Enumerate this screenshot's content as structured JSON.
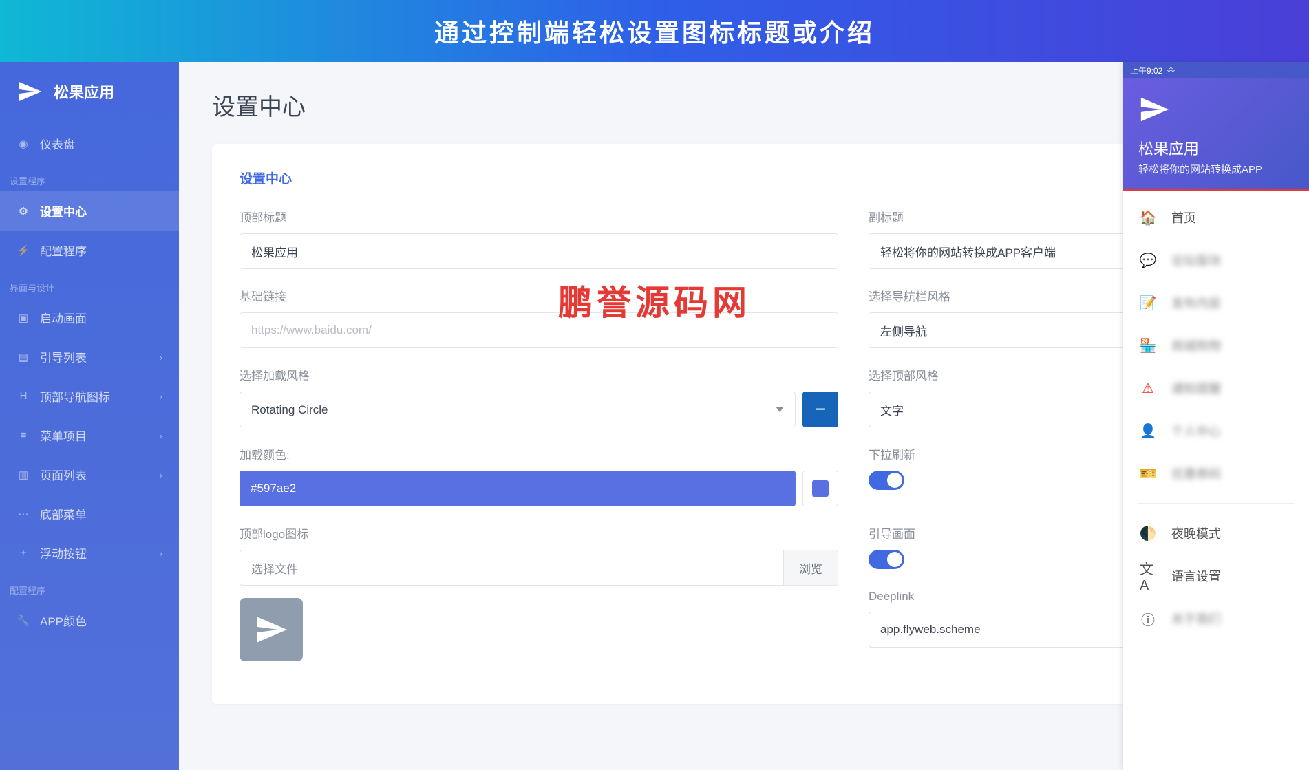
{
  "banner": "通过控制端轻松设置图标标题或介绍",
  "brand": "松果应用",
  "sidebar": {
    "dashboard": "仪表盘",
    "section_setup": "设置程序",
    "settings_center": "设置中心",
    "config_program": "配置程序",
    "section_design": "界面与设计",
    "splash": "启动画面",
    "guide_list": "引导列表",
    "top_nav_icons": "顶部导航图标",
    "menu_items": "菜单项目",
    "page_list": "页面列表",
    "bottom_menu": "底部菜单",
    "float_button": "浮动按钮",
    "section_config": "配置程序",
    "app_color": "APP颜色"
  },
  "page": {
    "title": "设置中心",
    "card_title": "设置中心"
  },
  "form": {
    "top_title_label": "顶部标题",
    "top_title_value": "松果应用",
    "subtitle_label": "副标题",
    "subtitle_value": "轻松将你的网站转换成APP客户端",
    "base_link_label": "基础链接",
    "base_link_placeholder": "https://www.baidu.com/",
    "nav_style_label": "选择导航栏风格",
    "nav_style_value": "左侧导航",
    "load_style_label": "选择加载风格",
    "load_style_value": "Rotating Circle",
    "top_style_label": "选择顶部风格",
    "top_style_value": "文字",
    "load_color_label": "加载颜色:",
    "load_color_value": "#597ae2",
    "pull_refresh_label": "下拉刷新",
    "logo_label": "顶部logo图标",
    "choose_file": "选择文件",
    "browse": "浏览",
    "guide_screen_label": "引导画面",
    "deeplink_label": "Deeplink",
    "deeplink_value": "app.flyweb.scheme"
  },
  "watermark": "鹏誉源码网",
  "phone": {
    "time": "上午9:02",
    "app_title": "松果应用",
    "app_sub": "轻松将你的网站转换成APP",
    "items": {
      "home": "首页",
      "night": "夜晚模式",
      "lang": "语言设置",
      "about": "关于我们"
    }
  }
}
